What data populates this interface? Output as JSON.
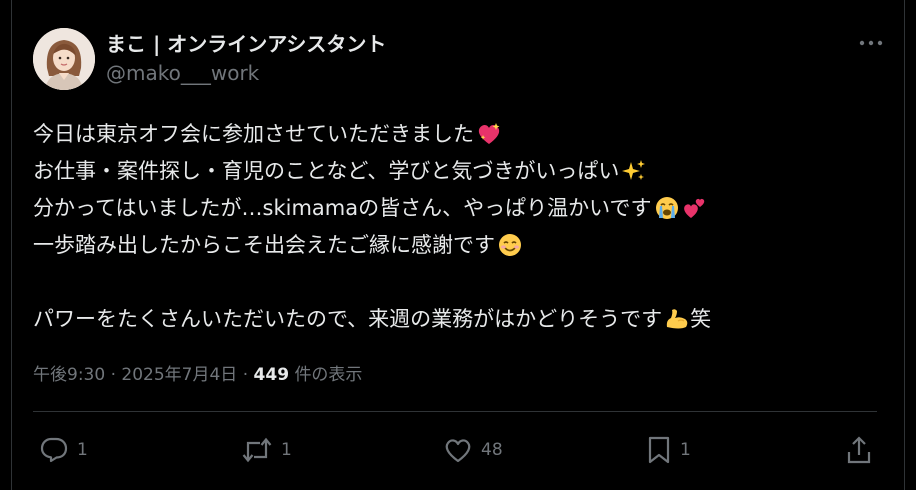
{
  "author": {
    "display_name": "まこ | オンラインアシスタント",
    "handle": "@mako___work",
    "avatar_icon": "avatar-woman-illustration"
  },
  "post": {
    "lines": [
      "今日は東京オフ会に参加させていただきました",
      "お仕事・案件探し・育児のことなど、学びと気づきがいっぱい",
      "分かってはいましたが…skimamaの皆さん、やっぱり温かいです",
      "一歩踏み出したからこそ出会えたご縁に感謝です",
      "",
      "パワーをたくさんいただいたので、来週の業務がはかどりそうです",
      "笑"
    ],
    "emojis": [
      "sparkling-heart-emoji",
      "sparkles-emoji",
      "crying-face-emoji",
      "two-hearts-emoji",
      "smiling-face-emoji",
      "flexed-biceps-emoji"
    ]
  },
  "meta": {
    "time": "午後9:30",
    "separator": "·",
    "date": "2025年7月4日",
    "views_count": "449",
    "views_label": "件の表示"
  },
  "actions": {
    "replies": "1",
    "reposts": "1",
    "likes": "48",
    "bookmarks": "1"
  },
  "colors": {
    "background": "#000000",
    "text": "#e7e9ea",
    "muted": "#71767b",
    "border": "#2f3336"
  }
}
